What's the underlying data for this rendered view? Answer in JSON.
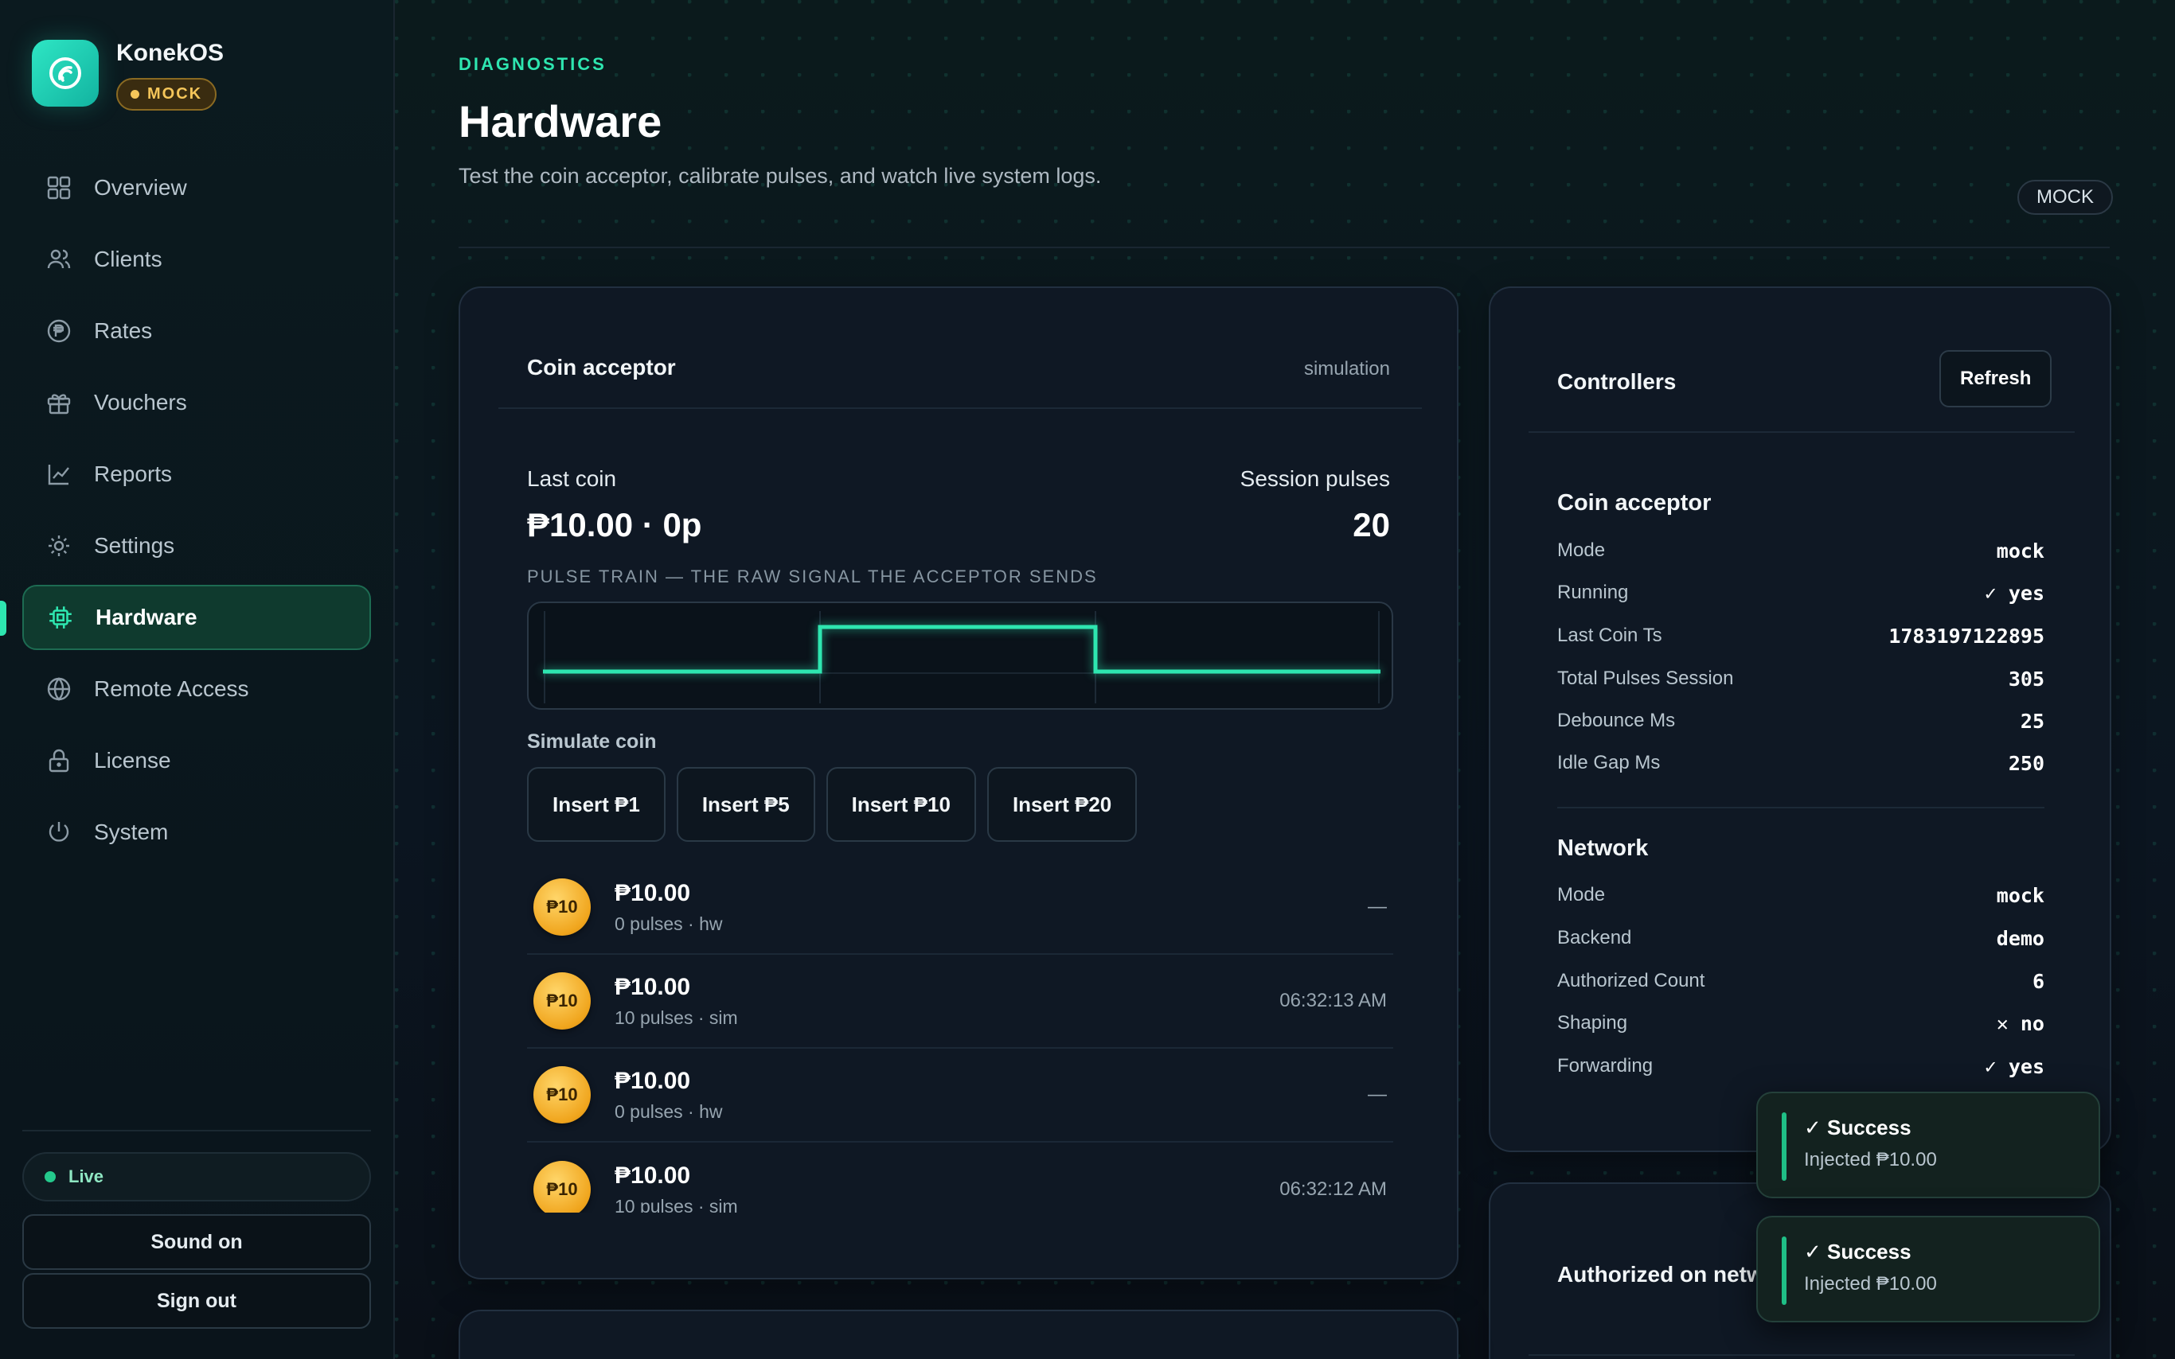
{
  "brand": {
    "name": "KonekOS",
    "mode_badge": "MOCK"
  },
  "nav": {
    "items": [
      {
        "label": "Overview",
        "icon": "grid-icon"
      },
      {
        "label": "Clients",
        "icon": "users-icon"
      },
      {
        "label": "Rates",
        "icon": "peso-icon"
      },
      {
        "label": "Vouchers",
        "icon": "gift-icon"
      },
      {
        "label": "Reports",
        "icon": "chart-icon"
      },
      {
        "label": "Settings",
        "icon": "sun-gear-icon"
      },
      {
        "label": "Hardware",
        "icon": "chip-icon",
        "active": true
      },
      {
        "label": "Remote Access",
        "icon": "globe-icon"
      },
      {
        "label": "License",
        "icon": "lock-icon"
      },
      {
        "label": "System",
        "icon": "power-icon"
      }
    ]
  },
  "sidebar_bottom": {
    "live_label": "Live",
    "sound_label": "Sound on",
    "signout_label": "Sign out"
  },
  "header": {
    "eyebrow": "DIAGNOSTICS",
    "title": "Hardware",
    "subtitle": "Test the coin acceptor, calibrate pulses, and watch live system logs.",
    "badge": "MOCK"
  },
  "coin_card": {
    "title": "Coin acceptor",
    "mode": "simulation",
    "last_coin_label": "Last coin",
    "last_coin_value": "₱10.00 · 0p",
    "session_pulses_label": "Session pulses",
    "session_pulses_value": "20",
    "pulse_train_label": "PULSE TRAIN — THE RAW SIGNAL THE ACCEPTOR SENDS",
    "simulate_label": "Simulate coin",
    "sim_buttons": [
      "Insert ₱1",
      "Insert ₱5",
      "Insert ₱10",
      "Insert ₱20"
    ],
    "coin_log": [
      {
        "badge": "₱10",
        "amount": "₱10.00",
        "meta": "0 pulses · hw",
        "time": "—"
      },
      {
        "badge": "₱10",
        "amount": "₱10.00",
        "meta": "10 pulses · sim",
        "time": "06:32:13 AM"
      },
      {
        "badge": "₱10",
        "amount": "₱10.00",
        "meta": "0 pulses · hw",
        "time": "—"
      },
      {
        "badge": "₱10",
        "amount": "₱10.00",
        "meta": "10 pulses · sim",
        "time": "06:32:12 AM"
      }
    ]
  },
  "controllers": {
    "title": "Controllers",
    "refresh_label": "Refresh",
    "coin_section": "Coin acceptor",
    "coin_rows": [
      {
        "key": "Mode",
        "value": "mock"
      },
      {
        "key": "Running",
        "value": "✓ yes"
      },
      {
        "key": "Last Coin Ts",
        "value": "1783197122895"
      },
      {
        "key": "Total Pulses Session",
        "value": "305"
      },
      {
        "key": "Debounce Ms",
        "value": "25"
      },
      {
        "key": "Idle Gap Ms",
        "value": "250"
      }
    ],
    "network_section": "Network",
    "network_rows": [
      {
        "key": "Mode",
        "value": "mock"
      },
      {
        "key": "Backend",
        "value": "demo"
      },
      {
        "key": "Authorized Count",
        "value": "6"
      },
      {
        "key": "Shaping",
        "value": "✕ no"
      },
      {
        "key": "Forwarding",
        "value": "✓ yes"
      }
    ]
  },
  "auth_card": {
    "title": "Authorized on netw"
  },
  "toasts": [
    {
      "title": "✓ Success",
      "message": "Injected ₱10.00"
    },
    {
      "title": "✓ Success",
      "message": "Injected ₱10.00"
    }
  ],
  "colors": {
    "accent": "#2ee6b0",
    "warning": "#f5c65a",
    "surface": "#0f1824",
    "coin": "#f0a51d"
  }
}
